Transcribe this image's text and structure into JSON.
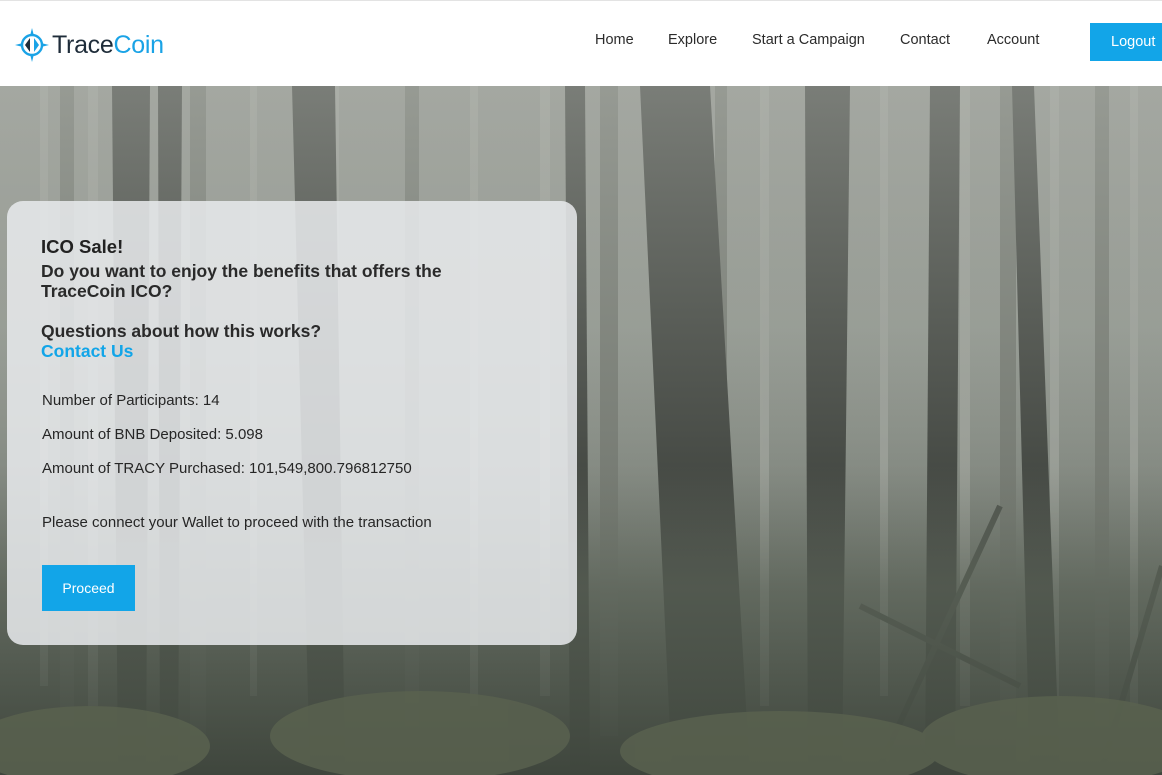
{
  "brand": {
    "name_part1": "Trace",
    "name_part2": "Coin",
    "accent_color": "#12a5e8",
    "logo_icon": "compass-logo-icon"
  },
  "nav": {
    "items": [
      {
        "label": "Home"
      },
      {
        "label": "Explore"
      },
      {
        "label": "Start a Campaign"
      },
      {
        "label": "Contact"
      },
      {
        "label": "Account"
      }
    ],
    "logout_label": "Logout"
  },
  "card": {
    "title": "ICO Sale!",
    "question_line1": "Do you want to enjoy the benefits that offers the",
    "question_line2": "TraceCoin ICO?",
    "questions": "Questions about how this works?",
    "contact_link": "Contact Us",
    "participants": "Number of Participants: 14",
    "bnb_deposited": "Amount of BNB Deposited: 5.098",
    "tracy_purchased": "Amount of TRACY Purchased: 101,549,800.796812750",
    "wallet_notice": "Please connect your Wallet to proceed with the transaction",
    "proceed_label": "Proceed"
  }
}
